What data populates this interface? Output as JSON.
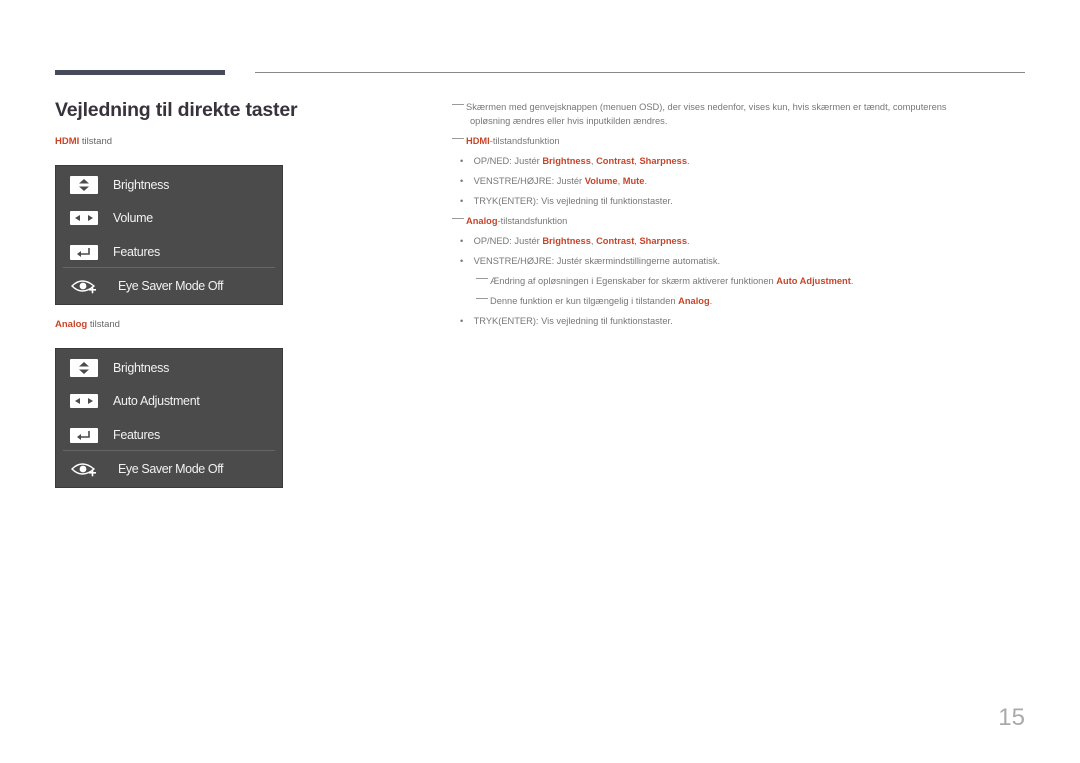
{
  "page": {
    "title": "Vejledning til direkte taster",
    "page_number": "15"
  },
  "hdmi_section": {
    "label_bold": "HDMI",
    "label_rest": " tilstand",
    "items": [
      {
        "icon": "up-down-key-icon",
        "label": "Brightness"
      },
      {
        "icon": "left-right-key-icon",
        "label": "Volume"
      },
      {
        "icon": "enter-key-icon",
        "label": "Features"
      }
    ],
    "eye_saver": "Eye Saver Mode Off"
  },
  "analog_section": {
    "label_bold": "Analog",
    "label_rest": " tilstand",
    "items": [
      {
        "icon": "up-down-key-icon",
        "label": "Brightness"
      },
      {
        "icon": "left-right-key-icon",
        "label": "Auto Adjustment"
      },
      {
        "icon": "enter-key-icon",
        "label": "Features"
      }
    ],
    "eye_saver": "Eye Saver Mode Off"
  },
  "notes": {
    "intro_line1": "Skærmen med genvejsknappen (menuen OSD), der vises nedenfor, vises kun, hvis skærmen er tændt, computerens",
    "intro_line2": "opløsning ændres eller hvis inputkilden ændres.",
    "hdmi_heading_bold": "HDMI",
    "hdmi_heading_rest": "-tilstandsfunktion",
    "hdmi_b1_pre": "OP/NED: Justér ",
    "hdmi_b1_h1": "Brightness",
    "hdmi_b1_h2": "Contrast",
    "hdmi_b1_h3": "Sharpness",
    "hdmi_b2_pre": "VENSTRE/HØJRE: Justér ",
    "hdmi_b2_h1": "Volume",
    "hdmi_b2_h2": "Mute",
    "hdmi_b3": "TRYK(ENTER): Vis vejledning til funktionstaster.",
    "analog_heading_bold": "Analog",
    "analog_heading_rest": "-tilstandsfunktion",
    "analog_b1_pre": "OP/NED: Justér ",
    "analog_b1_h1": "Brightness",
    "analog_b1_h2": "Contrast",
    "analog_b1_h3": "Sharpness",
    "analog_b2": "VENSTRE/HØJRE: Justér skærmindstillingerne automatisk.",
    "analog_sub1_pre": "Ændring af opløsningen i Egenskaber for skærm aktiverer funktionen ",
    "analog_sub1_h": "Auto Adjustment",
    "analog_sub2_pre": "Denne funktion er kun tilgængelig i tilstanden ",
    "analog_sub2_h": "Analog",
    "analog_b3": "TRYK(ENTER): Vis vejledning til funktionstaster.",
    "bullet": "•",
    "comma": ", ",
    "period": "."
  },
  "colors": {
    "accent": "#c8452a",
    "osd_bg": "#4b4b4b",
    "title": "#38323c"
  }
}
